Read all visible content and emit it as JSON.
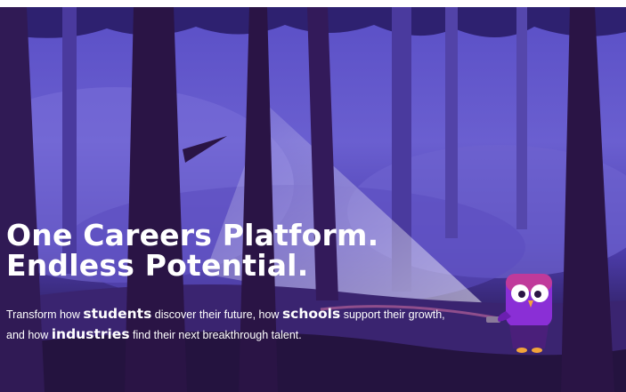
{
  "hero": {
    "headline_line1": "One Careers Platform.",
    "headline_line2": "Endless Potential.",
    "subtitle": {
      "part1": "Transform how ",
      "emph1": "students",
      "part2": " discover their future, how ",
      "emph2": "schools",
      "part3": " support their growth,",
      "part4": "and how ",
      "emph3": "industries",
      "part5": " find their next breakthrough talent."
    }
  },
  "colors": {
    "sky": "#6a5fd0",
    "ground": "#2b1a55",
    "tree": "#2a1445",
    "owl_body": "#8a2fd6",
    "text": "#ffffff"
  },
  "icons": {
    "mascot": "owl-flashlight-icon"
  }
}
